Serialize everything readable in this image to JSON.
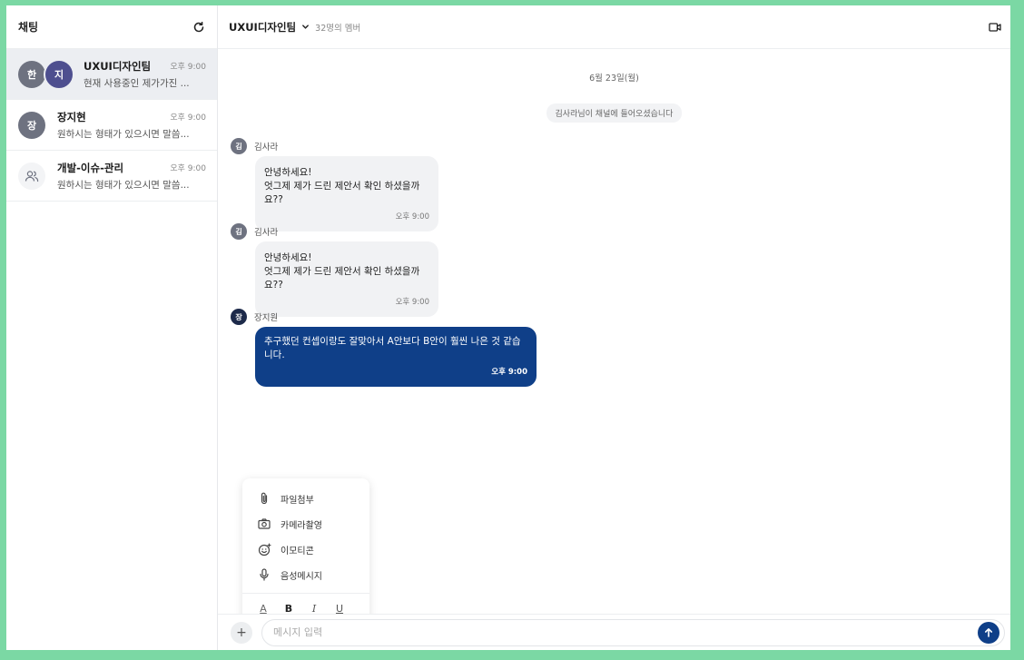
{
  "colors": {
    "frame": "#7bd8a4",
    "brand_navy": "#0f3f88",
    "active_row": "#eceef2"
  },
  "sidebar": {
    "title": "채팅",
    "refresh_icon": "refresh-icon",
    "rooms": [
      {
        "avatars": [
          "한",
          "지"
        ],
        "name": "UXUI디자인팀",
        "preview": "현재 사용중인 제가가진 ...",
        "time": "오후 9:00",
        "active": true
      },
      {
        "avatars": [
          "장"
        ],
        "name": "장지현",
        "preview": "원하시는 형태가 있으시면 말씀...",
        "time": "오후 9:00"
      },
      {
        "avatars": [
          "group-icon"
        ],
        "name": "개발-이슈-관리",
        "preview": "원하시는 형태가 있으시면 말씀...",
        "time": "오후 9:00"
      }
    ]
  },
  "header": {
    "channel_name": "UXUI디자인팀",
    "member_count": "32명의 멤버",
    "video_icon": "video-camera-icon"
  },
  "messages": {
    "date": "6월 23일(월)",
    "system": "김사라님이 채널에 들어오셨습니다",
    "items": [
      {
        "avatar": "김",
        "sender": "김사라",
        "lines": [
          "안녕하세요!",
          "엇그제 제가 드린 제안서 확인 하셨을까요??"
        ],
        "time": "오후 9:00"
      },
      {
        "avatar": "김",
        "sender": "김사라",
        "lines": [
          "안녕하세요!",
          "엇그제 제가 드린 제안서 확인 하셨을까요??"
        ],
        "time": "오후 9:00"
      },
      {
        "avatar": "장",
        "sender": "장지원",
        "lines": [
          "추구했던 컨셉이랑도 잘맞아서 A안보다 B안이 훨씬 나은 것 같습니다."
        ],
        "time": "오후 9:00",
        "mine": true
      }
    ]
  },
  "attach_menu": {
    "items": [
      {
        "icon": "paperclip-icon",
        "label": "파일첨부"
      },
      {
        "icon": "camera-icon",
        "label": "카메라촬영"
      },
      {
        "icon": "emoji-icon",
        "label": "이모티콘"
      },
      {
        "icon": "microphone-icon",
        "label": "음성메시지"
      }
    ],
    "format": {
      "color": "A",
      "bold": "B",
      "italic": "I",
      "underline": "U"
    }
  },
  "composer": {
    "plus": "+",
    "placeholder": "메시지 입력",
    "value": "",
    "send_icon": "arrow-up-icon"
  }
}
